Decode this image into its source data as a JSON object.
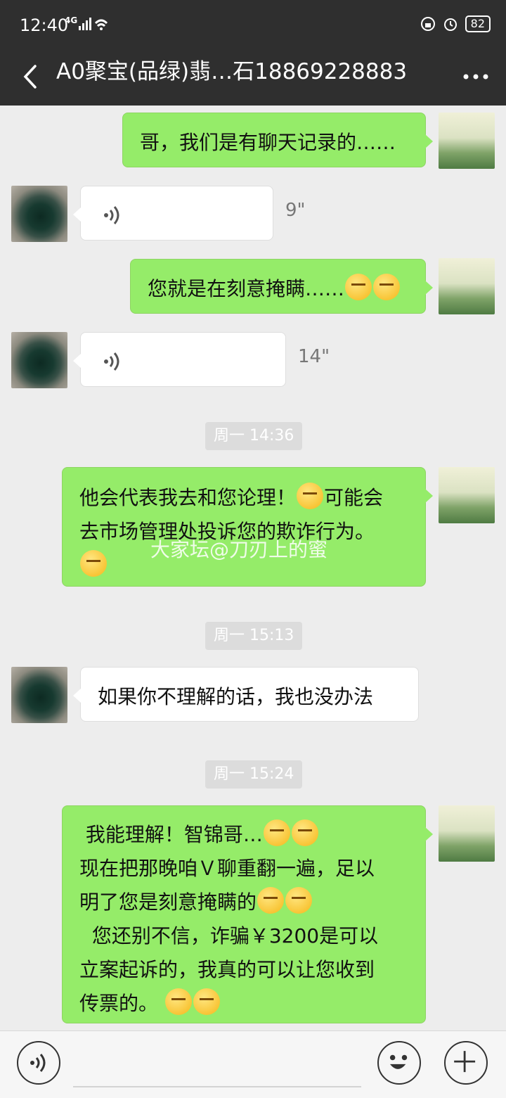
{
  "status_bar": {
    "time": "12:40",
    "network": "4G",
    "battery": "82"
  },
  "header": {
    "title": "A0聚宝(品绿)翡…石18869228883"
  },
  "messages": [
    {
      "text": "哥，我们是有聊天记录的……"
    },
    {
      "duration": "9\""
    },
    {
      "text": "您就是在刻意掩瞒……"
    },
    {
      "duration": "14\""
    },
    {
      "timestamp": "周一 14:36"
    },
    {
      "lines": [
        "他会代表我去和您论理！",
        "可能会",
        "去市场管理处投诉您的欺诈行为。"
      ]
    },
    {
      "timestamp": "周一 15:13"
    },
    {
      "text": "如果你不理解的话，我也没办法"
    },
    {
      "timestamp": "周一 15:24"
    },
    {
      "lines": [
        "我能理解！智锦哥…",
        "现在把那晚咱Ｖ聊重翻一遍，足以",
        "明了您是刻意掩瞒的",
        "您还别不信，诈骗￥3200是可以",
        "立案起诉的，我真的可以让您收到",
        "传票的。"
      ]
    }
  ],
  "watermark": "大家坛@刀刃上的蜜",
  "icons": {
    "back": "chevron-left-icon",
    "more": "more-icon",
    "voice": "voice-icon",
    "emoji": "emoji-icon",
    "add": "plus-icon"
  }
}
